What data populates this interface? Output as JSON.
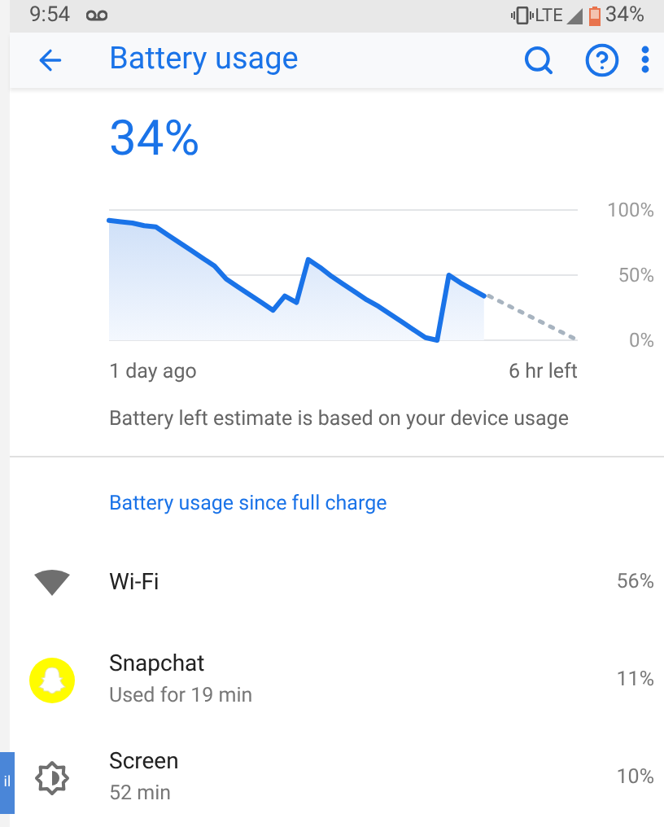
{
  "status_bar": {
    "time": "9:54",
    "network": "LTE",
    "battery": "34%"
  },
  "toolbar": {
    "title": "Battery usage"
  },
  "battery_level": "34%",
  "chart_data": {
    "type": "area",
    "categories": [
      null,
      null,
      null,
      null,
      null,
      null,
      null,
      null,
      null,
      null,
      null,
      null,
      null,
      null,
      null,
      null,
      null,
      null,
      null,
      null,
      null,
      null,
      null,
      null,
      null,
      null,
      null,
      null,
      null,
      null,
      null,
      null,
      null
    ],
    "series": [
      {
        "color": "#1a73e8",
        "values": [
          92,
          91,
          90,
          88,
          87,
          81,
          75,
          69,
          63,
          57,
          47,
          41,
          35,
          29,
          23,
          34,
          29,
          62,
          56,
          49,
          43,
          37,
          31,
          26,
          20,
          14,
          8,
          2,
          0,
          50,
          44,
          39,
          34
        ]
      }
    ],
    "ylim": [
      0,
      100
    ],
    "yticks": [
      {
        "value": 0,
        "label": "0%"
      },
      {
        "value": 50,
        "label": "50%"
      },
      {
        "value": 100,
        "label": "100%"
      }
    ]
  },
  "time_axis": {
    "start": "1 day ago",
    "end": "6 hr left"
  },
  "estimate_note": "Battery left estimate is based on your device usage",
  "section_title": "Battery usage since full charge",
  "usage": [
    {
      "kind": "wifi",
      "name": "Wi-Fi",
      "percent": "56%"
    },
    {
      "kind": "snapchat",
      "name": "Snapchat",
      "detail": "Used for 19 min",
      "percent": "11%"
    },
    {
      "kind": "screen",
      "name": "Screen",
      "detail": "52 min",
      "percent": "10%"
    }
  ],
  "edge_tab": {
    "text": "il"
  }
}
